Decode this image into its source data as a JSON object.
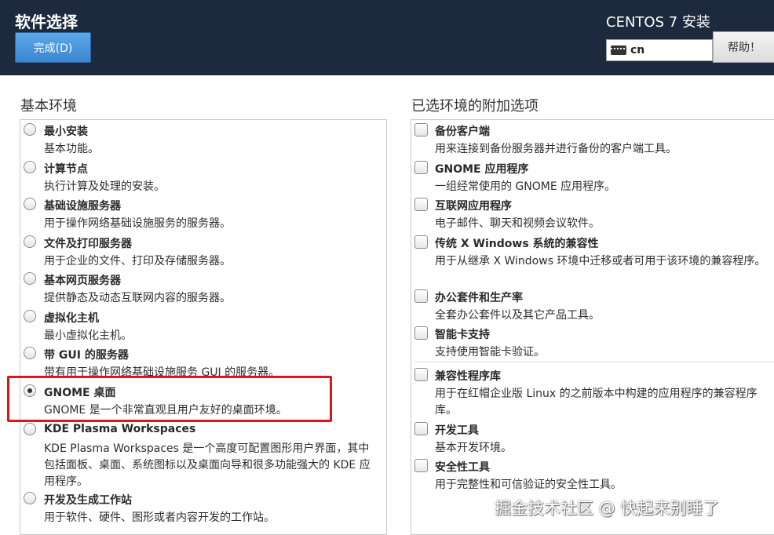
{
  "header": {
    "page_title": "软件选择",
    "done_label": "完成(D)",
    "product_title": "CENTOS 7 安装",
    "keyboard_layout": "cn",
    "help_label": "帮助！"
  },
  "base_env": {
    "heading": "基本环境",
    "items": [
      {
        "title": "最小安装",
        "desc": "基本功能。",
        "selected": false
      },
      {
        "title": "计算节点",
        "desc": "执行计算及处理的安装。",
        "selected": false
      },
      {
        "title": "基础设施服务器",
        "desc": "用于操作网络基础设施服务的服务器。",
        "selected": false
      },
      {
        "title": "文件及打印服务器",
        "desc": "用于企业的文件、打印及存储服务器。",
        "selected": false
      },
      {
        "title": "基本网页服务器",
        "desc": "提供静态及动态互联网内容的服务器。",
        "selected": false
      },
      {
        "title": "虚拟化主机",
        "desc": "最小虚拟化主机。",
        "selected": false
      },
      {
        "title": "带 GUI 的服务器",
        "desc": "带有用于操作网络基础设施服务 GUI 的服务器。",
        "selected": false
      },
      {
        "title": "GNOME 桌面",
        "desc": "GNOME 是一个非常直观且用户友好的桌面环境。",
        "selected": true
      },
      {
        "title": "KDE Plasma Workspaces",
        "desc": "KDE Plasma Workspaces 是一个高度可配置图形用户界面，其中包括面板、桌面、系统图标以及桌面向导和很多功能强大的 KDE 应用程序。",
        "selected": false
      },
      {
        "title": "开发及生成工作站",
        "desc": "用于软件、硬件、图形或者内容开发的工作站。",
        "selected": false
      }
    ]
  },
  "addons": {
    "heading": "已选环境的附加选项",
    "items": [
      {
        "title": "备份客户端",
        "desc": "用来连接到备份服务器并进行备份的客户端工具。",
        "checked": false
      },
      {
        "title": "GNOME 应用程序",
        "desc": "一组经常使用的 GNOME 应用程序。",
        "checked": false
      },
      {
        "title": "互联网应用程序",
        "desc": "电子邮件、聊天和视频会议软件。",
        "checked": false
      },
      {
        "title": "传统 X Windows 系统的兼容性",
        "desc": "用于从继承 X Windows 环境中迁移或者可用于该环境的兼容程序。",
        "checked": false
      },
      {
        "title": "办公套件和生产率",
        "desc": "全套办公套件以及其它产品工具。",
        "checked": false
      },
      {
        "title": "智能卡支持",
        "desc": "支持使用智能卡验证。",
        "checked": false
      },
      {
        "title": "兼容性程序库",
        "desc": "用于在红帽企业版 Linux 的之前版本中构建的应用程序的兼容程序库。",
        "checked": false
      },
      {
        "title": "开发工具",
        "desc": "基本开发环境。",
        "checked": false
      },
      {
        "title": "安全性工具",
        "desc": "用于完整性和可信验证的安全性工具。",
        "checked": false
      }
    ]
  },
  "watermark": "掘金技术社区 @ 快起来别睡了"
}
